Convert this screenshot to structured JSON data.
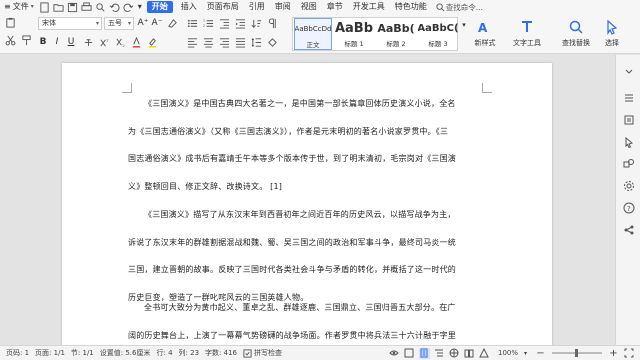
{
  "menubar": {
    "file_label": "文件",
    "tabs": [
      {
        "label": "开始",
        "active": true
      },
      {
        "label": "插入"
      },
      {
        "label": "页面布局"
      },
      {
        "label": "引用"
      },
      {
        "label": "审阅"
      },
      {
        "label": "视图"
      },
      {
        "label": "章节"
      },
      {
        "label": "开发工具"
      },
      {
        "label": "特色功能"
      }
    ],
    "search_label": "查找命令..."
  },
  "ribbon": {
    "font_name": "宋体",
    "font_size": "五号",
    "bold": "B",
    "italic": "I",
    "underline": "U",
    "styles": [
      {
        "preview": "AaBbCcDd",
        "name": "正文",
        "selected": true
      },
      {
        "preview": "AaBb",
        "name": "标题 1"
      },
      {
        "preview": "AaBb(",
        "name": "标题 2"
      },
      {
        "preview": "AaBbC(",
        "name": "标题 3"
      }
    ],
    "new_style_label": "新样式",
    "text_tools_label": "文字工具",
    "find_replace_label": "查找替换",
    "select_label": "选择"
  },
  "document": {
    "paragraphs": [
      {
        "lines": [
          "《三国演义》是中国古典四大名著之一，是中国第一部长篇章回体历史演义小说，全名",
          "为《三国志通俗演义》（又称《三国志演义》），作者是元末明初的著名小说家罗贯中。《三",
          "国志通俗演义》成书后有嘉靖壬午本等多个版本传于世，到了明末清初，毛宗岗对《三国演",
          "义》整顿回目、修正文辞、改换诗文。 [1]"
        ]
      },
      {
        "lines": [
          "《三国演义》描写了从东汉末年到西晋初年之间近百年的历史风云，以描写战争为主，",
          "诉说了东汉末年的群雄割据混战和魏、蜀、吴三国之间的政治和军事斗争，最终司马炎一统",
          "三国，建立晋朝的故事。反映了三国时代各类社会斗争与矛盾的转化，并概括了这一时代的",
          "历史巨变，塑造了一群叱咤风云的三国英雄人物。"
        ]
      },
      {
        "lines": [
          "全书可大致分为黄巾起义、董卓之乱、群雄逐鹿、三国鼎立、三国归晋五大部分。在广",
          "阔的历史舞台上，上演了一幕幕气势磅礴的战争场面。作者罗贯中将兵法三十六计融于字里"
        ]
      }
    ]
  },
  "statusbar": {
    "page": "页码: 1",
    "pages": "页面: 1/1",
    "section": "节: 1/1",
    "position": "设置值: 5.6厘米",
    "row": "行: 4",
    "column": "列: 23",
    "word_count": "字数: 416",
    "spell_check": "拼写检查",
    "zoom": "100%"
  },
  "colors": {
    "accent": "#2f6ee8"
  }
}
